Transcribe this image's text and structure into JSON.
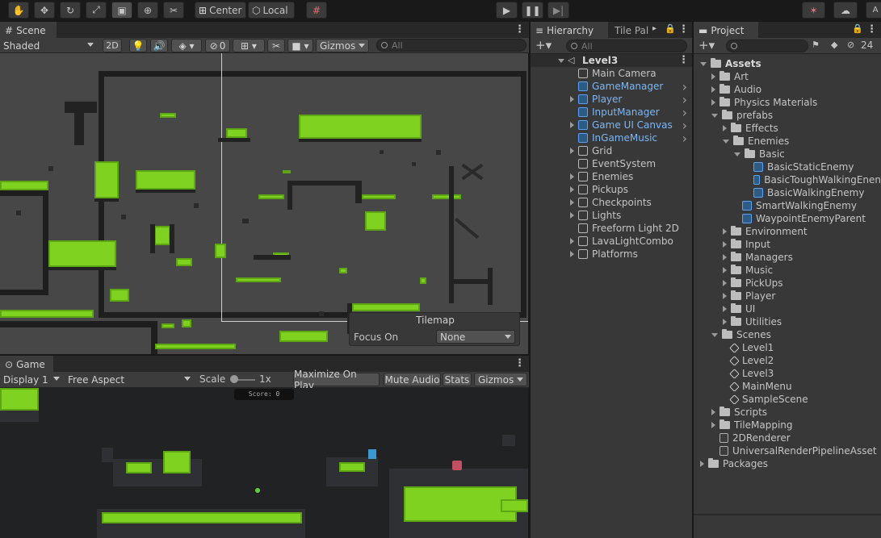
{
  "toolbar": {
    "pivot_label": "Center",
    "space_label": "Local",
    "tool_icons": [
      "hand-icon",
      "move-icon",
      "rotate-icon",
      "scale-icon",
      "rect-icon",
      "transform-icon",
      "custom-tools-icon"
    ],
    "play_icons": [
      "play-icon",
      "pause-icon",
      "step-icon"
    ]
  },
  "scene": {
    "tab_label": "Scene",
    "shading_mode": "Shaded",
    "mode_2d": "2D",
    "hidden_count": "0",
    "gizmos_label": "Gizmos",
    "search_placeholder": "All",
    "overlay": {
      "title": "Tilemap",
      "focus_label": "Focus On",
      "focus_value": "None"
    }
  },
  "game": {
    "tab_label": "Game",
    "display": "Display 1",
    "aspect": "Free Aspect",
    "scale_label": "Scale",
    "scale_value": "1x",
    "maximize_label": "Maximize On Play",
    "mute_label": "Mute Audio",
    "stats_label": "Stats",
    "gizmos_label": "Gizmos",
    "score_text": "Score: 0"
  },
  "hierarchy": {
    "tab_label": "Hierarchy",
    "tab2_label": "Tile Pal",
    "search_placeholder": "All",
    "root": "Level3",
    "items": [
      {
        "label": "Main Camera",
        "blue": false,
        "fold": false,
        "chev": false
      },
      {
        "label": "GameManager",
        "blue": true,
        "fold": false,
        "chev": true
      },
      {
        "label": "Player",
        "blue": true,
        "fold": true,
        "chev": true
      },
      {
        "label": "InputManager",
        "blue": true,
        "fold": false,
        "chev": true
      },
      {
        "label": "Game UI Canvas",
        "blue": true,
        "fold": true,
        "chev": true
      },
      {
        "label": "InGameMusic",
        "blue": true,
        "fold": false,
        "chev": true
      },
      {
        "label": "Grid",
        "blue": false,
        "fold": true,
        "chev": false
      },
      {
        "label": "EventSystem",
        "blue": false,
        "fold": false,
        "chev": false
      },
      {
        "label": "Enemies",
        "blue": false,
        "fold": true,
        "chev": false
      },
      {
        "label": "Pickups",
        "blue": false,
        "fold": true,
        "chev": false
      },
      {
        "label": "Checkpoints",
        "blue": false,
        "fold": true,
        "chev": false
      },
      {
        "label": "Lights",
        "blue": false,
        "fold": true,
        "chev": false
      },
      {
        "label": "Freeform Light 2D",
        "blue": false,
        "fold": false,
        "chev": false
      },
      {
        "label": "LavaLightCombo",
        "blue": false,
        "fold": true,
        "chev": false
      },
      {
        "label": "Platforms",
        "blue": false,
        "fold": true,
        "chev": false
      }
    ]
  },
  "project": {
    "tab_label": "Project",
    "hidden_count": "24",
    "items": [
      {
        "label": "Assets",
        "depth": 0,
        "type": "folder",
        "fold": "open",
        "bold": true
      },
      {
        "label": "Art",
        "depth": 1,
        "type": "folder",
        "fold": "closed"
      },
      {
        "label": "Audio",
        "depth": 1,
        "type": "folder",
        "fold": "closed"
      },
      {
        "label": "Physics Materials",
        "depth": 1,
        "type": "folder",
        "fold": "closed"
      },
      {
        "label": "prefabs",
        "depth": 1,
        "type": "folder",
        "fold": "open"
      },
      {
        "label": "Effects",
        "depth": 2,
        "type": "folder",
        "fold": "closed"
      },
      {
        "label": "Enemies",
        "depth": 2,
        "type": "folder",
        "fold": "open"
      },
      {
        "label": "Basic",
        "depth": 3,
        "type": "folder",
        "fold": "open"
      },
      {
        "label": "BasicStaticEnemy",
        "depth": 4,
        "type": "prefab",
        "fold": "none"
      },
      {
        "label": "BasicToughWalkingEnen",
        "depth": 4,
        "type": "prefab",
        "fold": "none"
      },
      {
        "label": "BasicWalkingEnemy",
        "depth": 4,
        "type": "prefab",
        "fold": "none"
      },
      {
        "label": "SmartWalkingEnemy",
        "depth": 3,
        "type": "prefab",
        "fold": "none"
      },
      {
        "label": "WaypointEnemyParent",
        "depth": 3,
        "type": "prefab",
        "fold": "none"
      },
      {
        "label": "Environment",
        "depth": 2,
        "type": "folder",
        "fold": "closed"
      },
      {
        "label": "Input",
        "depth": 2,
        "type": "folder",
        "fold": "closed"
      },
      {
        "label": "Managers",
        "depth": 2,
        "type": "folder",
        "fold": "closed"
      },
      {
        "label": "Music",
        "depth": 2,
        "type": "folder",
        "fold": "closed"
      },
      {
        "label": "PickUps",
        "depth": 2,
        "type": "folder",
        "fold": "closed"
      },
      {
        "label": "Player",
        "depth": 2,
        "type": "folder",
        "fold": "closed"
      },
      {
        "label": "UI",
        "depth": 2,
        "type": "folder",
        "fold": "closed"
      },
      {
        "label": "Utilities",
        "depth": 2,
        "type": "folder",
        "fold": "closed"
      },
      {
        "label": "Scenes",
        "depth": 1,
        "type": "folder",
        "fold": "open"
      },
      {
        "label": "Level1",
        "depth": 2,
        "type": "scene",
        "fold": "none"
      },
      {
        "label": "Level2",
        "depth": 2,
        "type": "scene",
        "fold": "none"
      },
      {
        "label": "Level3",
        "depth": 2,
        "type": "scene",
        "fold": "none"
      },
      {
        "label": "MainMenu",
        "depth": 2,
        "type": "scene",
        "fold": "none"
      },
      {
        "label": "SampleScene",
        "depth": 2,
        "type": "scene",
        "fold": "none"
      },
      {
        "label": "Scripts",
        "depth": 1,
        "type": "folder",
        "fold": "closed"
      },
      {
        "label": "TileMapping",
        "depth": 1,
        "type": "folder",
        "fold": "closed"
      },
      {
        "label": "2DRenderer",
        "depth": 1,
        "type": "asset",
        "fold": "none"
      },
      {
        "label": "UniversalRenderPipelineAsset",
        "depth": 1,
        "type": "asset",
        "fold": "none"
      },
      {
        "label": "Packages",
        "depth": 0,
        "type": "folder",
        "fold": "closed"
      }
    ]
  },
  "colors": {
    "accent_blue": "#7cb7f5",
    "grass_green": "#7fd320",
    "panel_bg": "#383838"
  }
}
